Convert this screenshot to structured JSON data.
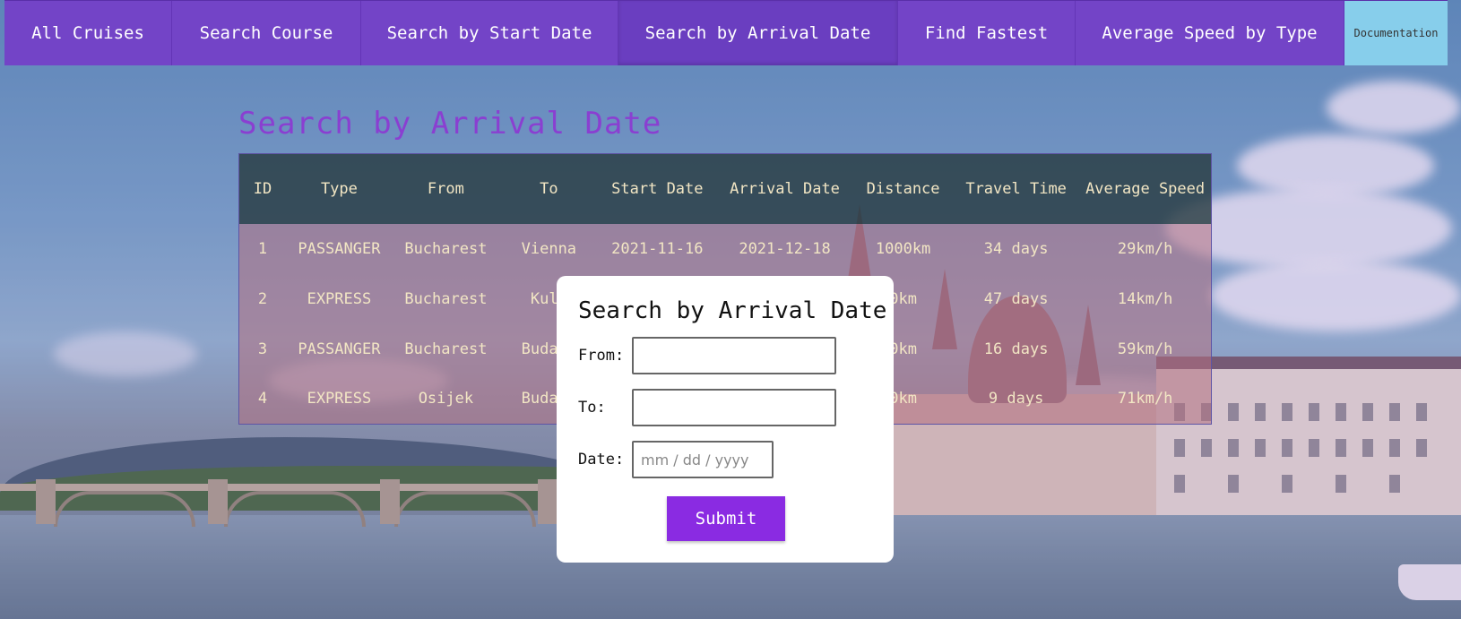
{
  "nav": {
    "items": [
      {
        "label": "All Cruises"
      },
      {
        "label": "Search Course"
      },
      {
        "label": "Search by Start Date"
      },
      {
        "label": "Search by Arrival Date"
      },
      {
        "label": "Find Fastest"
      },
      {
        "label": "Average Speed by Type"
      }
    ],
    "documentation_label": "Documentation",
    "active_index": 3
  },
  "page": {
    "heading": "Search by Arrival Date"
  },
  "table": {
    "headers": [
      "ID",
      "Type",
      "From",
      "To",
      "Start Date",
      "Arrival Date",
      "Distance",
      "Travel Time",
      "Average Speed"
    ],
    "rows": [
      [
        "1",
        "PASSANGER",
        "Bucharest",
        "Vienna",
        "2021-11-16",
        "2021-12-18",
        "1000km",
        "34 days",
        "29km/h"
      ],
      [
        "2",
        "EXPRESS",
        "Bucharest",
        "Kulc",
        "",
        "",
        "0km",
        "47 days",
        "14km/h"
      ],
      [
        "3",
        "PASSANGER",
        "Bucharest",
        "Budape",
        "",
        "",
        "0km",
        "16 days",
        "59km/h"
      ],
      [
        "4",
        "EXPRESS",
        "Osijek",
        "Budape",
        "",
        "",
        "0km",
        "9 days",
        "71km/h"
      ]
    ]
  },
  "modal": {
    "title": "Search by Arrival Date",
    "from_label": "From:",
    "from_value": "",
    "to_label": "To:",
    "to_value": "",
    "date_label": "Date:",
    "date_placeholder": "mm / dd / yyyy",
    "submit_label": "Submit"
  },
  "colors": {
    "nav_bg": "#7344c7",
    "documentation_bg": "#87ceeb",
    "heading": "#8a3fd1",
    "submit_bg": "#8a2be2"
  }
}
